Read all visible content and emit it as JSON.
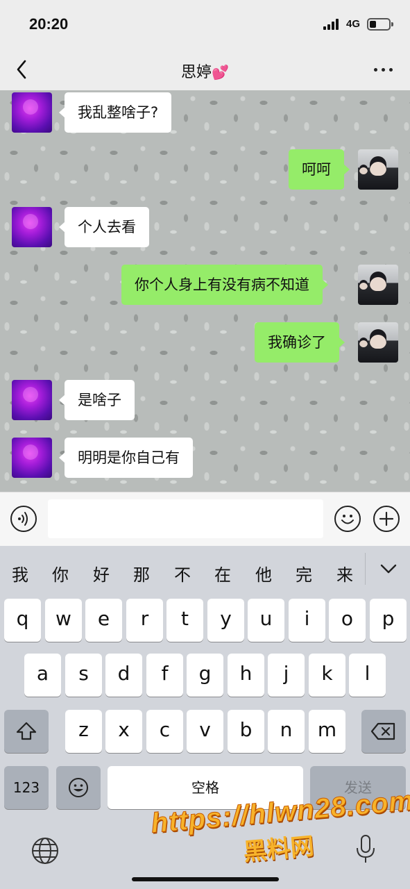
{
  "status_bar": {
    "time": "20:20",
    "network": "4G"
  },
  "nav": {
    "title": "思婷",
    "title_emoji": "💕"
  },
  "messages": [
    {
      "side": "in",
      "text": "我乱整啥子?"
    },
    {
      "side": "out",
      "text": "呵呵"
    },
    {
      "side": "in",
      "text": "个人去看"
    },
    {
      "side": "out",
      "text": "你个人身上有没有病不知道"
    },
    {
      "side": "out",
      "text": "我确诊了"
    },
    {
      "side": "in",
      "text": "是啥子"
    },
    {
      "side": "in",
      "text": "明明是你自己有"
    }
  ],
  "input": {
    "value": ""
  },
  "keyboard": {
    "candidates": [
      "我",
      "你",
      "好",
      "那",
      "不",
      "在",
      "他",
      "完",
      "来"
    ],
    "row1": [
      "q",
      "w",
      "e",
      "r",
      "t",
      "y",
      "u",
      "i",
      "o",
      "p"
    ],
    "row2": [
      "a",
      "s",
      "d",
      "f",
      "g",
      "h",
      "j",
      "k",
      "l"
    ],
    "row3": [
      "z",
      "x",
      "c",
      "v",
      "b",
      "n",
      "m"
    ],
    "numbers_label": "123",
    "space_label": "空格",
    "send_label": "发送"
  },
  "watermark": {
    "url": "https://hlwn28.com",
    "text": "黑料网"
  },
  "icons": [
    "back-icon",
    "more-icon",
    "voice-icon",
    "emoji-icon",
    "plus-icon",
    "chevron-down-icon",
    "shift-icon",
    "delete-icon",
    "emoji-key-icon",
    "globe-icon",
    "microphone-icon"
  ],
  "colors": {
    "outgoing_bubble": "#95ec69",
    "incoming_bubble": "#ffffff",
    "keyboard_bg": "#d2d5db"
  }
}
